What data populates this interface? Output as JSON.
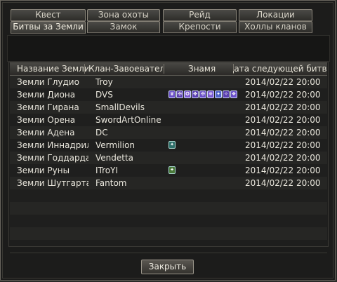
{
  "tabs_row1": [
    {
      "label": "Квест"
    },
    {
      "label": "Зона охоты"
    },
    {
      "label": "Рейд"
    },
    {
      "label": "Локации"
    }
  ],
  "tabs_row2": [
    {
      "label": "Битвы за Земли"
    },
    {
      "label": "Замок"
    },
    {
      "label": "Крепости"
    },
    {
      "label": "Холлы кланов"
    }
  ],
  "table": {
    "headers": {
      "land": "Название Земли",
      "clan": "Клан-Завоеватель",
      "flag": "Знамя",
      "date": "Дата следующей битвы"
    },
    "rows": [
      {
        "land": "Земли Глудио",
        "clan": "Troy",
        "date": "2014/02/22 20:00",
        "crests": 0
      },
      {
        "land": "Земли Диона",
        "clan": "DVS",
        "date": "2014/02/22 20:00",
        "crests": 9
      },
      {
        "land": "Земли Гирана",
        "clan": "SmallDevils",
        "date": "2014/02/22 20:00",
        "crests": 0
      },
      {
        "land": "Земли Орена",
        "clan": "SwordArtOnline",
        "date": "2014/02/22 20:00",
        "crests": 0
      },
      {
        "land": "Земли Адена",
        "clan": "DC",
        "date": "2014/02/22 20:00",
        "crests": 0
      },
      {
        "land": "Земли Иннадрила",
        "clan": "Vermilion",
        "date": "2014/02/22 20:00",
        "crests": 1
      },
      {
        "land": "Земли Годдарда",
        "clan": "Vendetta",
        "date": "2014/02/22 20:00",
        "crests": 0
      },
      {
        "land": "Земли Руны",
        "clan": "ITroYI",
        "date": "2014/02/22 20:00",
        "crests": 1
      },
      {
        "land": "Земли Шутгарта",
        "clan": "Fantom",
        "date": "2014/02/22 20:00",
        "crests": 0
      }
    ]
  },
  "close_label": "Закрыть",
  "colors": {
    "crest_purple": "#5b3fb0",
    "crest_teal": "#2e6f6a",
    "crest_green": "#4a7a3a"
  }
}
